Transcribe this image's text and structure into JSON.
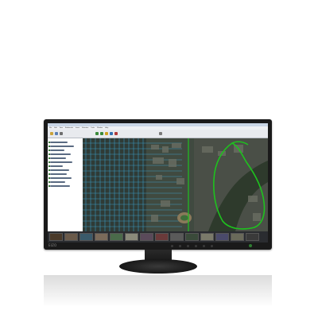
{
  "window": {
    "title": "",
    "menu_items": [
      "File",
      "Edit",
      "View",
      "Bookmarks",
      "Insert",
      "Selection",
      "Tools",
      "Window",
      "Help"
    ]
  },
  "monitor": {
    "brand_logo": "EIZO"
  },
  "colors": {
    "bezel": "#1a1a1a",
    "map_background": "#3e4a3e",
    "road_grid": "#3fa8d8",
    "boundary_outline": "#1ec21e",
    "thumbstrip": "#2a2c30"
  },
  "icons": {
    "toolbar": [
      "open-icon",
      "save-icon",
      "zoom-in-icon",
      "zoom-out-icon",
      "pan-icon",
      "identify-icon",
      "measure-icon",
      "select-icon",
      "add-data-icon"
    ],
    "toc": "layer-checkbox-icon"
  },
  "thumbnails": {
    "count": 16
  }
}
